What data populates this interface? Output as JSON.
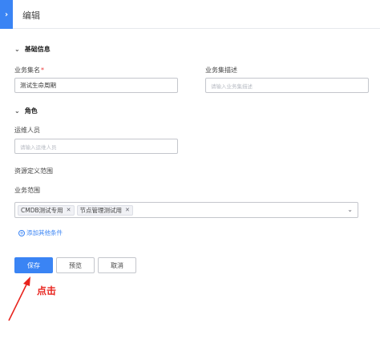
{
  "header": {
    "title": "编辑",
    "expand_icon": "chevron-right-icon"
  },
  "sections": {
    "basic": {
      "title": "基础信息"
    },
    "roles": {
      "title": "角色"
    }
  },
  "fields": {
    "name": {
      "label": "业务集名",
      "required_mark": "*",
      "value": "测试生命周期"
    },
    "description": {
      "label": "业务集描述",
      "placeholder": "请输入业务集描述"
    },
    "maintainer": {
      "label": "运维人员",
      "placeholder": "请输入运维人员"
    }
  },
  "resource_scope": {
    "title": "资源定义范围",
    "business_scope_label": "业务范围",
    "tags": [
      {
        "label": "CMDB测试专用"
      },
      {
        "label": "节点管理测试用"
      }
    ],
    "add_condition_label": "添加其他条件"
  },
  "actions": {
    "save": "保存",
    "preview": "预览",
    "cancel": "取消"
  },
  "annotation": {
    "text": "点击",
    "color": "#e8241e"
  },
  "colors": {
    "primary": "#3a84f4",
    "required": "#ea3636"
  }
}
